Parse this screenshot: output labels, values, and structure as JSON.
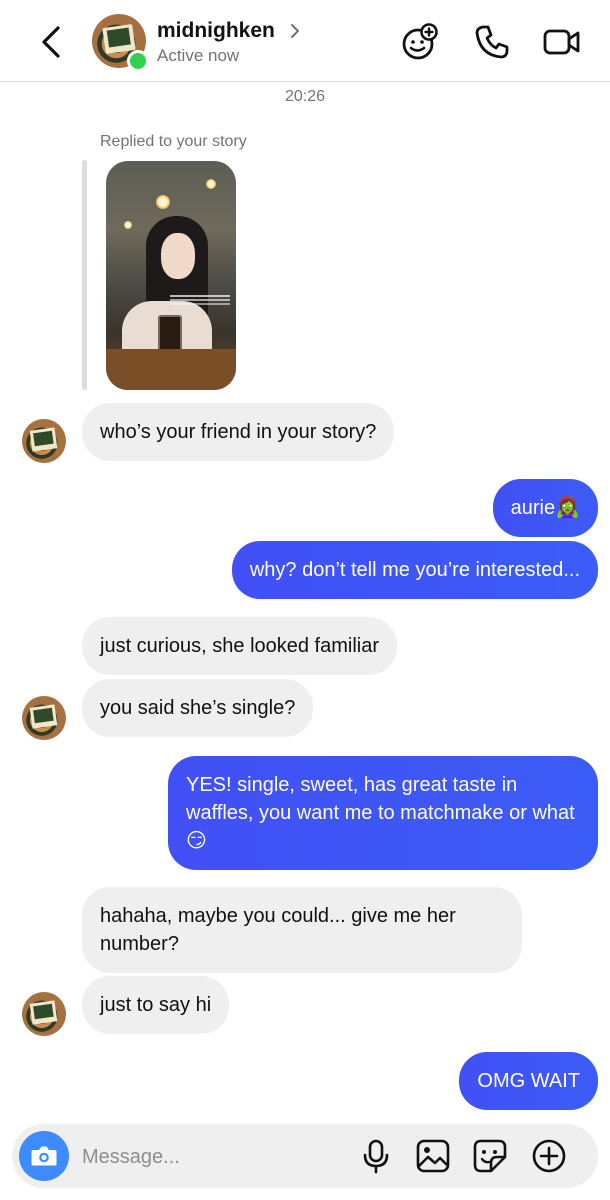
{
  "header": {
    "username": "midnighken",
    "status": "Active now",
    "icons": [
      "back-arrow-icon",
      "chevron-right-icon",
      "effects-face-icon",
      "phone-icon",
      "video-camera-icon"
    ]
  },
  "conversation": {
    "timestamp": "20:26",
    "story_reply_caption": "Replied to your story",
    "messages": [
      {
        "from": "them",
        "text": "who’s your friend in your story?"
      },
      {
        "from": "me",
        "text": "aurie🧟‍♀️"
      },
      {
        "from": "me",
        "text": "why? don’t tell me you’re interested..."
      },
      {
        "from": "them",
        "text": "just curious, she looked familiar"
      },
      {
        "from": "them",
        "text": "you said she’s single?"
      },
      {
        "from": "me",
        "text": "YES! single, sweet, has great taste in waffles, you want me to matchmake or what 😏"
      },
      {
        "from": "them",
        "text": "hahaha, maybe you could... give me her number?"
      },
      {
        "from": "them",
        "text": "just to say hi"
      },
      {
        "from": "me",
        "text": "OMG WAIT"
      }
    ]
  },
  "composer": {
    "placeholder": "Message...",
    "icons": [
      "camera-icon",
      "microphone-icon",
      "gallery-icon",
      "sticker-icon",
      "plus-icon"
    ]
  },
  "colors": {
    "outgoing_bubble": "#3d5afe",
    "incoming_bubble": "#efefef",
    "online_dot": "#2fd24a",
    "camera_button": "#3d8bff"
  }
}
